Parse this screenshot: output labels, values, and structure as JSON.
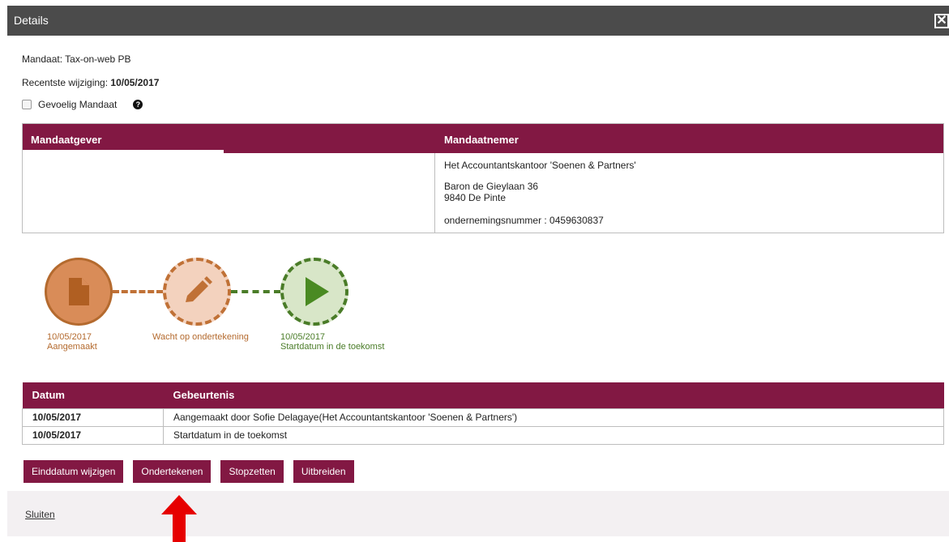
{
  "dialog": {
    "title": "Details",
    "close_icon": "close-icon",
    "close_label": "✕"
  },
  "info": {
    "mandaat": "Mandaat: Tax-on-web PB",
    "recent_label": "Recentste wijziging: ",
    "recent_value": "10/05/2017",
    "gevoelig_label": "Gevoelig Mandaat",
    "help_icon": "?"
  },
  "parties": {
    "mandaatgever_header": "Mandaatgever",
    "mandaatnemer_header": "Mandaatnemer",
    "mandaatnemer": {
      "name": "Het Accountantskantoor 'Soenen & Partners'",
      "street": "Baron de Gieylaan 36",
      "city": "9840 De Pinte",
      "company_no": "ondernemingsnummer : 0459630837"
    }
  },
  "timeline": {
    "steps": [
      {
        "date": "10/05/2017",
        "label": "Aangemaakt",
        "icon": "document-icon"
      },
      {
        "date": "",
        "label": "Wacht op ondertekening",
        "icon": "pencil-icon"
      },
      {
        "date": "10/05/2017",
        "label": "Startdatum in de toekomst",
        "icon": "play-icon"
      }
    ],
    "colors": {
      "orange": "#c07136",
      "green": "#4a7c28"
    }
  },
  "events": {
    "headers": [
      "Datum",
      "Gebeurtenis"
    ],
    "rows": [
      [
        "10/05/2017",
        "Aangemaakt door Sofie Delagaye(Het Accountantskantoor 'Soenen & Partners')"
      ],
      [
        "10/05/2017",
        "Startdatum in de toekomst"
      ]
    ]
  },
  "actions": {
    "einddatum": "Einddatum wijzigen",
    "ondertekenen": "Ondertekenen",
    "stopzetten": "Stopzetten",
    "uitbreiden": "Uitbreiden"
  },
  "footer": {
    "sluiten": "Sluiten"
  },
  "colors": {
    "accent": "#821843",
    "titlebar": "#4b4b4b",
    "arrow": "#e60000"
  }
}
